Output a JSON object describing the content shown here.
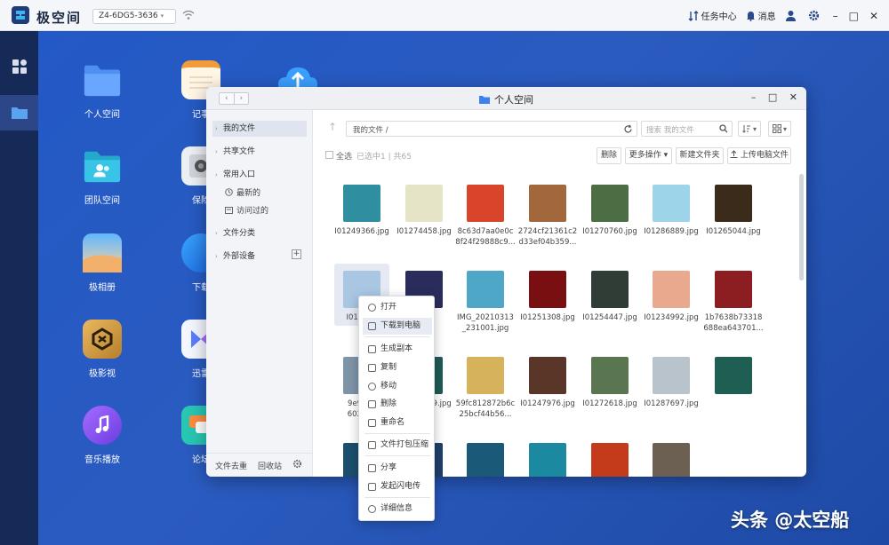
{
  "app": {
    "title": "极空间",
    "device": "Z4-6DG5-3636"
  },
  "topbar": {
    "task_center": "任务中心",
    "messages": "消息",
    "minimize": "–",
    "maximize": "□",
    "close": "✕"
  },
  "desktop_icons": [
    {
      "label": "个人空间",
      "icon": "folder-icon"
    },
    {
      "label": "团队空间",
      "icon": "team-folder-icon"
    },
    {
      "label": "极相册",
      "icon": "photo-album-icon"
    },
    {
      "label": "极影视",
      "icon": "video-icon"
    },
    {
      "label": "音乐播放",
      "icon": "music-icon"
    },
    {
      "label": "记事",
      "icon": "notes-icon"
    },
    {
      "label": "保险",
      "icon": "safe-icon"
    },
    {
      "label": "下载",
      "icon": "download-icon"
    },
    {
      "label": "迅雷",
      "icon": "xunlei-icon"
    },
    {
      "label": "论坛",
      "icon": "forum-icon"
    }
  ],
  "window": {
    "title": "个人空间",
    "nav_back": "‹",
    "nav_forward": "›",
    "minimize": "–",
    "maximize": "□",
    "close": "✕"
  },
  "sidebar": {
    "my_files": "我的文件",
    "shared_files": "共享文件",
    "common_entry": "常用入口",
    "recent": "最新的",
    "visited": "访问过的",
    "categories": "文件分类",
    "external": "外部设备",
    "plus": "+",
    "dedupe": "文件去重",
    "recycle": "回收站"
  },
  "pathbar": {
    "path": "我的文件 /",
    "search_placeholder": "搜索 我的文件"
  },
  "toolbar": {
    "select_all": "全选",
    "selected_info": "已选中1 | 共65",
    "delete": "删除",
    "more": "更多操作",
    "new_folder": "新建文件夹",
    "upload": "上传电脑文件"
  },
  "files": [
    {
      "name": [
        "I01249366.jpg"
      ],
      "color": "#2f8ea0"
    },
    {
      "name": [
        "I01274458.jpg"
      ],
      "color": "#e6e4c6"
    },
    {
      "name": [
        "8c63d7aa0e0c",
        "8f24f29888c9..."
      ],
      "color": "#d9452b"
    },
    {
      "name": [
        "2724cf21361c2",
        "d33ef04b359..."
      ],
      "color": "#a2673a"
    },
    {
      "name": [
        "I01270760.jpg"
      ],
      "color": "#4c6e45"
    },
    {
      "name": [
        "I01286889.jpg"
      ],
      "color": "#9ed4e9"
    },
    {
      "name": [
        "I01265044.jpg"
      ],
      "color": "#3a2b1a"
    },
    {
      "name": [
        "I012467"
      ],
      "color": "#a9c6e3"
    },
    {
      "name": [
        ""
      ],
      "color": "#2a2c5c"
    },
    {
      "name": [
        "IMG_20210313",
        "_231001.jpg"
      ],
      "color": "#4fa7c8"
    },
    {
      "name": [
        "I01251308.jpg"
      ],
      "color": "#7a0f12"
    },
    {
      "name": [
        "I01254447.jpg"
      ],
      "color": "#2f3d36"
    },
    {
      "name": [
        "I01234992.jpg"
      ],
      "color": "#e9a98e"
    },
    {
      "name": [
        "1b7638b73318",
        "688ea643701..."
      ],
      "color": "#8c1e22"
    },
    {
      "name": [
        "9e9a2e",
        "602224"
      ],
      "color": "#7e95a8"
    },
    {
      "name": [
        "I01271279.jpg"
      ],
      "color": "#1f5a56"
    },
    {
      "name": [
        "59fc812872b6c",
        "25bcf44b56..."
      ],
      "color": "#d6b25a"
    },
    {
      "name": [
        "I01247976.jpg"
      ],
      "color": "#5a3628"
    },
    {
      "name": [
        "I01272618.jpg"
      ],
      "color": "#5a7650"
    },
    {
      "name": [
        "I01287697.jpg"
      ],
      "color": "#b9c3cb"
    },
    {
      "name": [
        ""
      ],
      "color": "#1f5e53"
    },
    {
      "name": [
        ""
      ],
      "color": "#1b4f6e"
    },
    {
      "name": [
        ""
      ],
      "color": "#1f3f6a"
    },
    {
      "name": [
        ""
      ],
      "color": "#1a5a78"
    },
    {
      "name": [
        ""
      ],
      "color": "#1b8aa0"
    },
    {
      "name": [
        ""
      ],
      "color": "#c43b1b"
    },
    {
      "name": [
        ""
      ],
      "color": "#6b6052"
    }
  ],
  "context_menu": [
    {
      "label": "打开"
    },
    {
      "label": "下载到电脑"
    },
    {
      "label": "生成副本"
    },
    {
      "label": "复制"
    },
    {
      "label": "移动"
    },
    {
      "label": "删除"
    },
    {
      "label": "重命名"
    },
    {
      "label": "文件打包压缩"
    },
    {
      "label": "分享"
    },
    {
      "label": "发起闪电传"
    },
    {
      "label": "详细信息"
    }
  ],
  "watermark": "头条 @太空船",
  "colors": {
    "accent": "#2a5bbf",
    "rail": "#152a57",
    "selected": "#dfe4ee"
  }
}
